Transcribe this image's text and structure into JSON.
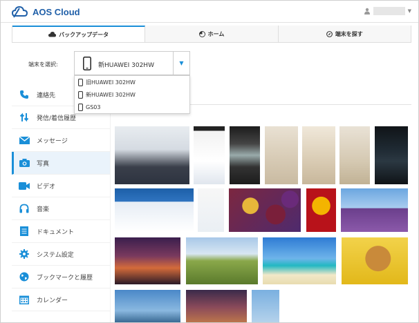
{
  "app": {
    "title": "AOS Cloud"
  },
  "tabs": [
    {
      "label": "バックアップデータ",
      "icon": "cloud-icon",
      "active": true
    },
    {
      "label": "ホーム",
      "icon": "pie-icon",
      "active": false
    },
    {
      "label": "端末を探す",
      "icon": "compass-icon",
      "active": false
    }
  ],
  "device": {
    "label": "端末を選択:",
    "selected": "新HUAWEI 302HW",
    "options": [
      "旧HUAWEI 302HW",
      "新HUAWEI 302HW",
      "GS03"
    ]
  },
  "sidebar": {
    "items": [
      {
        "label": "連絡先",
        "icon": "phone-icon"
      },
      {
        "label": "発信/着信履歴",
        "icon": "call-history-icon"
      },
      {
        "label": "メッセージ",
        "icon": "envelope-icon"
      },
      {
        "label": "写真",
        "icon": "camera-icon",
        "active": true
      },
      {
        "label": "ビデオ",
        "icon": "video-icon"
      },
      {
        "label": "音楽",
        "icon": "headphones-icon"
      },
      {
        "label": "ドキュメント",
        "icon": "document-icon"
      },
      {
        "label": "システム設定",
        "icon": "gear-icon"
      },
      {
        "label": "ブックマークと履歴",
        "icon": "globe-icon"
      },
      {
        "label": "カレンダー",
        "icon": "calendar-icon"
      }
    ]
  },
  "colors": {
    "brand": "#1f5fa8",
    "accent": "#1a8fd8",
    "active_bg": "#eaf3fb"
  }
}
